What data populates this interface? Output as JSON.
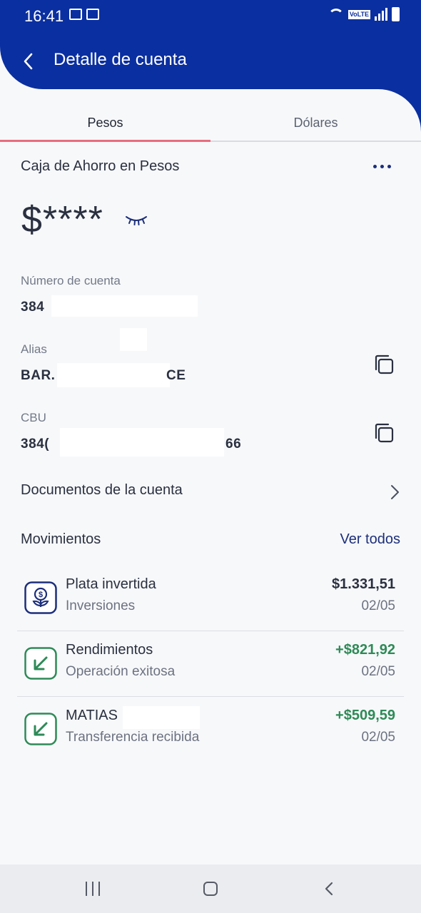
{
  "status_bar": {
    "time": "16:41"
  },
  "header": {
    "title": "Detalle de cuenta"
  },
  "tabs": [
    {
      "label": "Pesos",
      "active": true
    },
    {
      "label": "Dólares",
      "active": false
    }
  ],
  "account": {
    "type": "Caja de Ahorro en Pesos",
    "balance": "$****",
    "balance_hidden": true,
    "number_label": "Número de cuenta",
    "number_value": "384",
    "alias_label": "Alias",
    "alias_value_start": "BAR.",
    "alias_value_end": "CE",
    "cbu_label": "CBU",
    "cbu_value_start": "384(",
    "cbu_value_end": "66"
  },
  "documents": {
    "label": "Documentos de la cuenta"
  },
  "movements": {
    "title": "Movimientos",
    "see_all": "Ver todos",
    "items": [
      {
        "name": "Plata invertida",
        "subtitle": "Inversiones",
        "amount": "$1.331,51",
        "date": "02/05",
        "icon": "investment-icon",
        "positive": false
      },
      {
        "name": "Rendimientos",
        "subtitle": "Operación exitosa",
        "amount": "+$821,92",
        "date": "02/05",
        "icon": "arrow-in-icon",
        "positive": true
      },
      {
        "name": "MATIAS",
        "subtitle": "Transferencia recibida",
        "amount": "+$509,59",
        "date": "02/05",
        "icon": "arrow-in-icon",
        "positive": true
      }
    ]
  },
  "colors": {
    "header_bg": "#0a2fa0",
    "tab_indicator": "#e86d7f",
    "link": "#1d2f7a",
    "positive_amount": "#2e8a57"
  }
}
